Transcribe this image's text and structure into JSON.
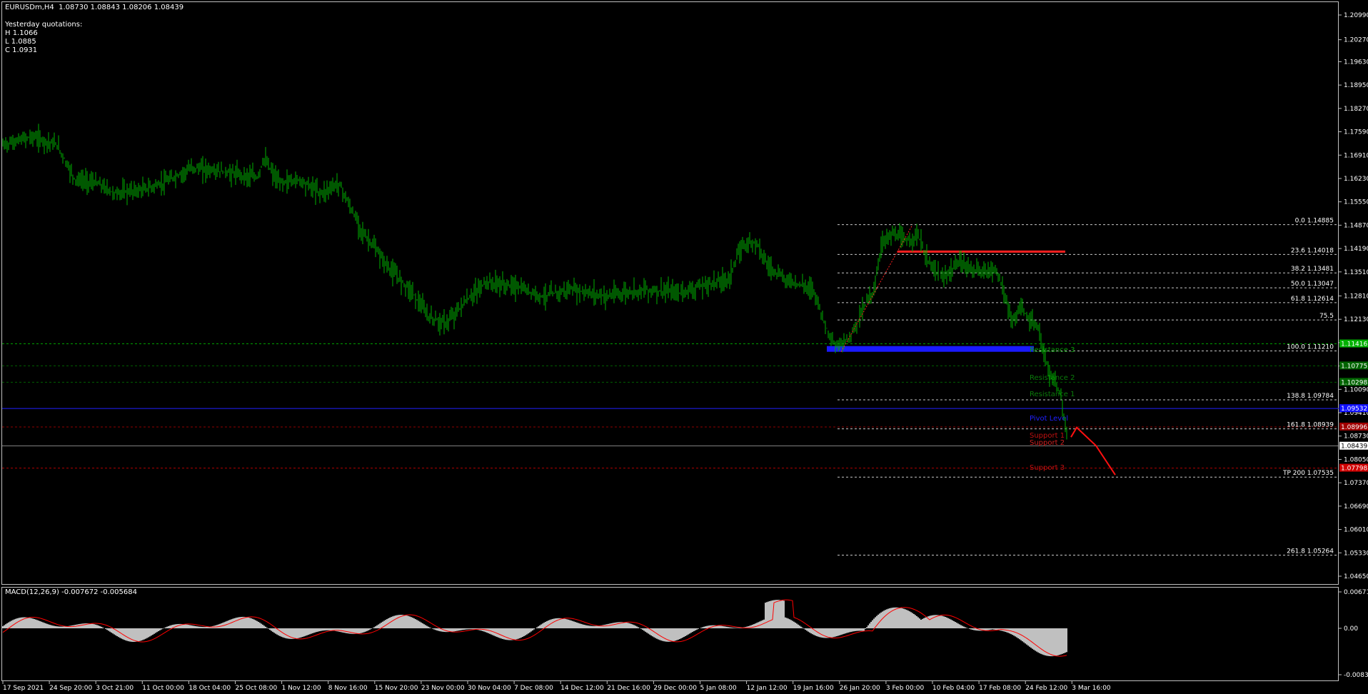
{
  "header": {
    "symbol_line": "EURUSDm,H4  1.08730 1.08843 1.08206 1.08439",
    "yesterday_title": "Yesterday quotations:",
    "high": "H 1.1066",
    "low": "L 1.0885",
    "close": "C 1.0931"
  },
  "macd": {
    "label": "MACD(12,26,9) -0.007672 -0.005684",
    "axis": [
      "0.006714",
      "0.00",
      "-0.008357"
    ]
  },
  "price_axis": [
    "1.20990",
    "1.20270",
    "1.19630",
    "1.18950",
    "1.18270",
    "1.17590",
    "1.16910",
    "1.16230",
    "1.15550",
    "1.14870",
    "1.14190",
    "1.13510",
    "1.12810",
    "1.12130",
    "1.11450",
    "1.10770",
    "1.10090",
    "1.09410",
    "1.08730",
    "1.08050",
    "1.07370",
    "1.06690",
    "1.06010",
    "1.05330",
    "1.04650"
  ],
  "time_axis": [
    "17 Sep 2021",
    "24 Sep 20:00",
    "3 Oct 21:00",
    "11 Oct 00:00",
    "18 Oct 04:00",
    "25 Oct 08:00",
    "1 Nov 12:00",
    "8 Nov 16:00",
    "15 Nov 20:00",
    "23 Nov 00:00",
    "30 Nov 04:00",
    "7 Dec 08:00",
    "14 Dec 12:00",
    "21 Dec 16:00",
    "29 Dec 00:00",
    "5 Jan 08:00",
    "12 Jan 12:00",
    "19 Jan 16:00",
    "26 Jan 20:00",
    "3 Feb 00:00",
    "10 Feb 04:00",
    "17 Feb 08:00",
    "24 Feb 12:00",
    "3 Mar 16:00"
  ],
  "fibo_levels": [
    {
      "label": "0.0 1.14885",
      "price": 1.14885
    },
    {
      "label": "23.6 1.14018",
      "price": 1.14018
    },
    {
      "label": "38.2 1.13481",
      "price": 1.13481
    },
    {
      "label": "50.0 1.13047",
      "price": 1.13047
    },
    {
      "label": "61.8 1.12614",
      "price": 1.12614
    },
    {
      "label": "75.5",
      "price": 1.12111
    },
    {
      "label": "100.0 1.11210",
      "price": 1.1121
    },
    {
      "label": "138.8 1.09784",
      "price": 1.09784
    },
    {
      "label": "161.8 1.08939",
      "price": 1.08939
    },
    {
      "label": "TP 200 1.07535",
      "price": 1.07535
    },
    {
      "label": "261.8 1.05264",
      "price": 1.05264
    }
  ],
  "pivot_labels": [
    {
      "label": "Resistance 3",
      "price": 1.1118,
      "color": "#0a9a0a"
    },
    {
      "label": "Resistance 2",
      "price": 1.1037,
      "color": "#0a7a0a"
    },
    {
      "label": "Resistance 1",
      "price": 1.0989,
      "color": "#0a7a0a"
    },
    {
      "label": "Pivot Level",
      "price": 1.0918,
      "color": "#2020ff"
    },
    {
      "label": "Support 1",
      "price": 1.0868,
      "color": "#c01010"
    },
    {
      "label": "Support 2",
      "price": 1.0848,
      "color": "#d02020"
    },
    {
      "label": "Support 3",
      "price": 1.0775,
      "color": "#c01010"
    }
  ],
  "price_tags": [
    {
      "text": "1.11416",
      "price": 1.11416,
      "bg": "#00b000"
    },
    {
      "text": "1.10775",
      "price": 1.10775,
      "bg": "#006400"
    },
    {
      "text": "1.10298",
      "price": 1.10298,
      "bg": "#006400"
    },
    {
      "text": "1.09532",
      "price": 1.09532,
      "bg": "#1010ff"
    },
    {
      "text": "1.08996",
      "price": 1.08996,
      "bg": "#a00000"
    },
    {
      "text": "1.08439",
      "price": 1.08439,
      "bg": "#ffffff",
      "fg": "#000000"
    },
    {
      "text": "1.07798",
      "price": 1.07798,
      "bg": "#d00000"
    }
  ],
  "colors": {
    "candles": "#00b000",
    "fibo": "#c8c8c8",
    "macd_hist": "#c0c0c0",
    "macd_signal": "#ff0000"
  }
}
